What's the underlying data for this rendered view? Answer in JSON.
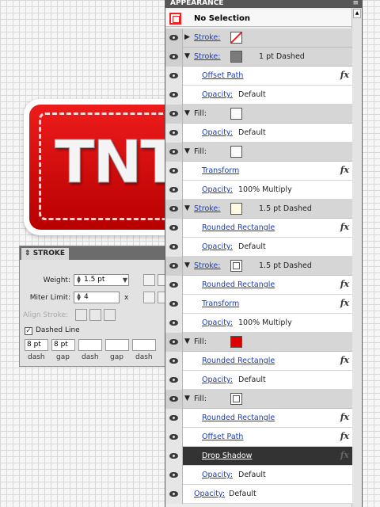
{
  "artwork": {
    "text": "TNT"
  },
  "stroke_panel": {
    "tab": "STROKE",
    "weight_label": "Weight:",
    "weight_value": "1.5 pt",
    "miter_label": "Miter Limit:",
    "miter_value": "4",
    "miter_unit": "x",
    "align_label": "Align Stroke:",
    "dashed_label": "Dashed Line",
    "dashed_checked": true,
    "fields": [
      {
        "value": "8 pt",
        "label": "dash"
      },
      {
        "value": "8 pt",
        "label": "gap"
      },
      {
        "value": "",
        "label": "dash"
      },
      {
        "value": "",
        "label": "gap"
      },
      {
        "value": "",
        "label": "dash"
      }
    ]
  },
  "appearance": {
    "title": "APPEARANCE",
    "menu": "≡",
    "header": "No Selection",
    "rows": [
      {
        "kind": "attr",
        "tri": "▶",
        "label": "Stroke:",
        "swatch": "none",
        "value": ""
      },
      {
        "kind": "attr",
        "tri": "▼",
        "label": "Stroke:",
        "swatch": "gray",
        "value": "1 pt Dashed"
      },
      {
        "kind": "sub",
        "link": true,
        "label": "Offset Path",
        "fx": true
      },
      {
        "kind": "sub",
        "link": true,
        "label": "Opacity:",
        "value": "Default"
      },
      {
        "kind": "attr",
        "tri": "▼",
        "label": "Fill:",
        "fill": true,
        "swatch": "white"
      },
      {
        "kind": "sub",
        "link": true,
        "label": "Opacity:",
        "value": "Default"
      },
      {
        "kind": "attr",
        "tri": "▼",
        "label": "Fill:",
        "fill": true,
        "swatch": "white"
      },
      {
        "kind": "sub",
        "link": true,
        "label": "Transform",
        "fx": true
      },
      {
        "kind": "sub",
        "link": true,
        "label": "Opacity:",
        "value": "100% Multiply"
      },
      {
        "kind": "attr",
        "tri": "▼",
        "label": "Stroke:",
        "swatch": "cream",
        "value": "1.5 pt Dashed"
      },
      {
        "kind": "sub",
        "link": true,
        "label": "Rounded Rectangle",
        "fx": true
      },
      {
        "kind": "sub",
        "link": true,
        "label": "Opacity:",
        "value": "Default"
      },
      {
        "kind": "attr",
        "tri": "▼",
        "label": "Stroke:",
        "swatch": "ring",
        "value": "1.5 pt Dashed"
      },
      {
        "kind": "sub",
        "link": true,
        "label": "Rounded Rectangle",
        "fx": true
      },
      {
        "kind": "sub",
        "link": true,
        "label": "Transform",
        "fx": true
      },
      {
        "kind": "sub",
        "link": true,
        "label": "Opacity:",
        "value": "100% Multiply"
      },
      {
        "kind": "attr",
        "tri": "▼",
        "label": "Fill:",
        "fill": true,
        "swatch": "red"
      },
      {
        "kind": "sub",
        "link": true,
        "label": "Rounded Rectangle",
        "fx": true
      },
      {
        "kind": "sub",
        "link": true,
        "label": "Opacity:",
        "value": "Default"
      },
      {
        "kind": "attr",
        "tri": "▼",
        "label": "Fill:",
        "fill": true,
        "swatch": "ring"
      },
      {
        "kind": "sub",
        "link": true,
        "label": "Rounded Rectangle",
        "fx": true
      },
      {
        "kind": "sub",
        "link": true,
        "label": "Offset Path",
        "fx": true
      },
      {
        "kind": "dark",
        "label": "Drop Shadow",
        "fx": true
      },
      {
        "kind": "sub",
        "link": true,
        "label": "Opacity:",
        "value": "Default"
      },
      {
        "kind": "top",
        "link": true,
        "label": "Opacity:",
        "value": "Default"
      }
    ]
  },
  "colors": {
    "accent_red": "#dd0000",
    "link_blue": "#1a3cb8",
    "panel_gray": "#ececec"
  }
}
